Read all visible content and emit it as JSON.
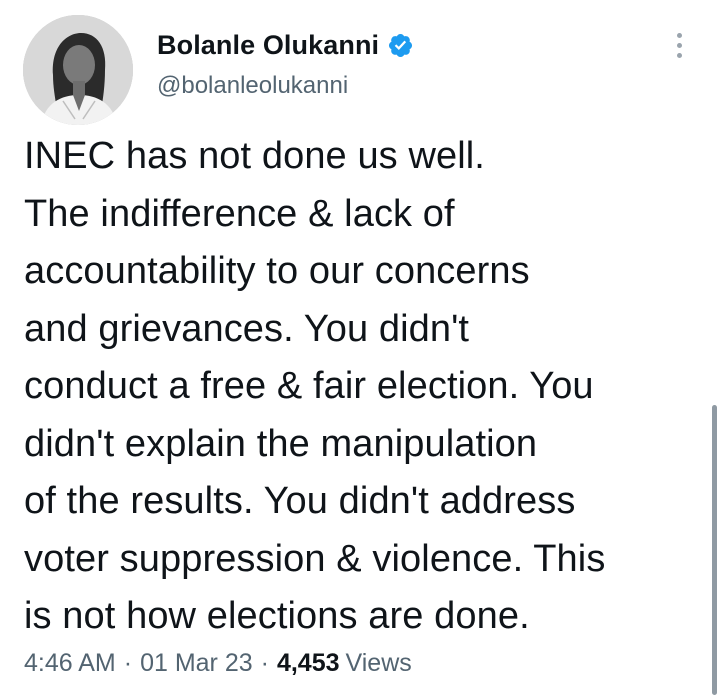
{
  "author": {
    "display_name": "Bolanle Olukanni",
    "handle": "@bolanleolukanni",
    "verified": true,
    "verified_color": "#1d9bf0",
    "avatar_icon": "profile-photo"
  },
  "more_icon": "more-vertical-icon",
  "tweet": {
    "lines": [
      "INEC has not done us well.",
      "The indifference & lack of",
      "accountability to our concerns",
      "and grievances. You didn't",
      "conduct a free & fair election. You",
      "didn't explain the manipulation",
      "of the results. You didn't address",
      "voter suppression & violence. This",
      "is not how elections are done."
    ]
  },
  "meta": {
    "time": "4:46 AM",
    "separator": "·",
    "date": "01 Mar 23",
    "views_count": "4,453",
    "views_label": "Views"
  },
  "colors": {
    "text_primary": "#0f1419",
    "text_secondary": "#536471",
    "background": "#ffffff"
  }
}
